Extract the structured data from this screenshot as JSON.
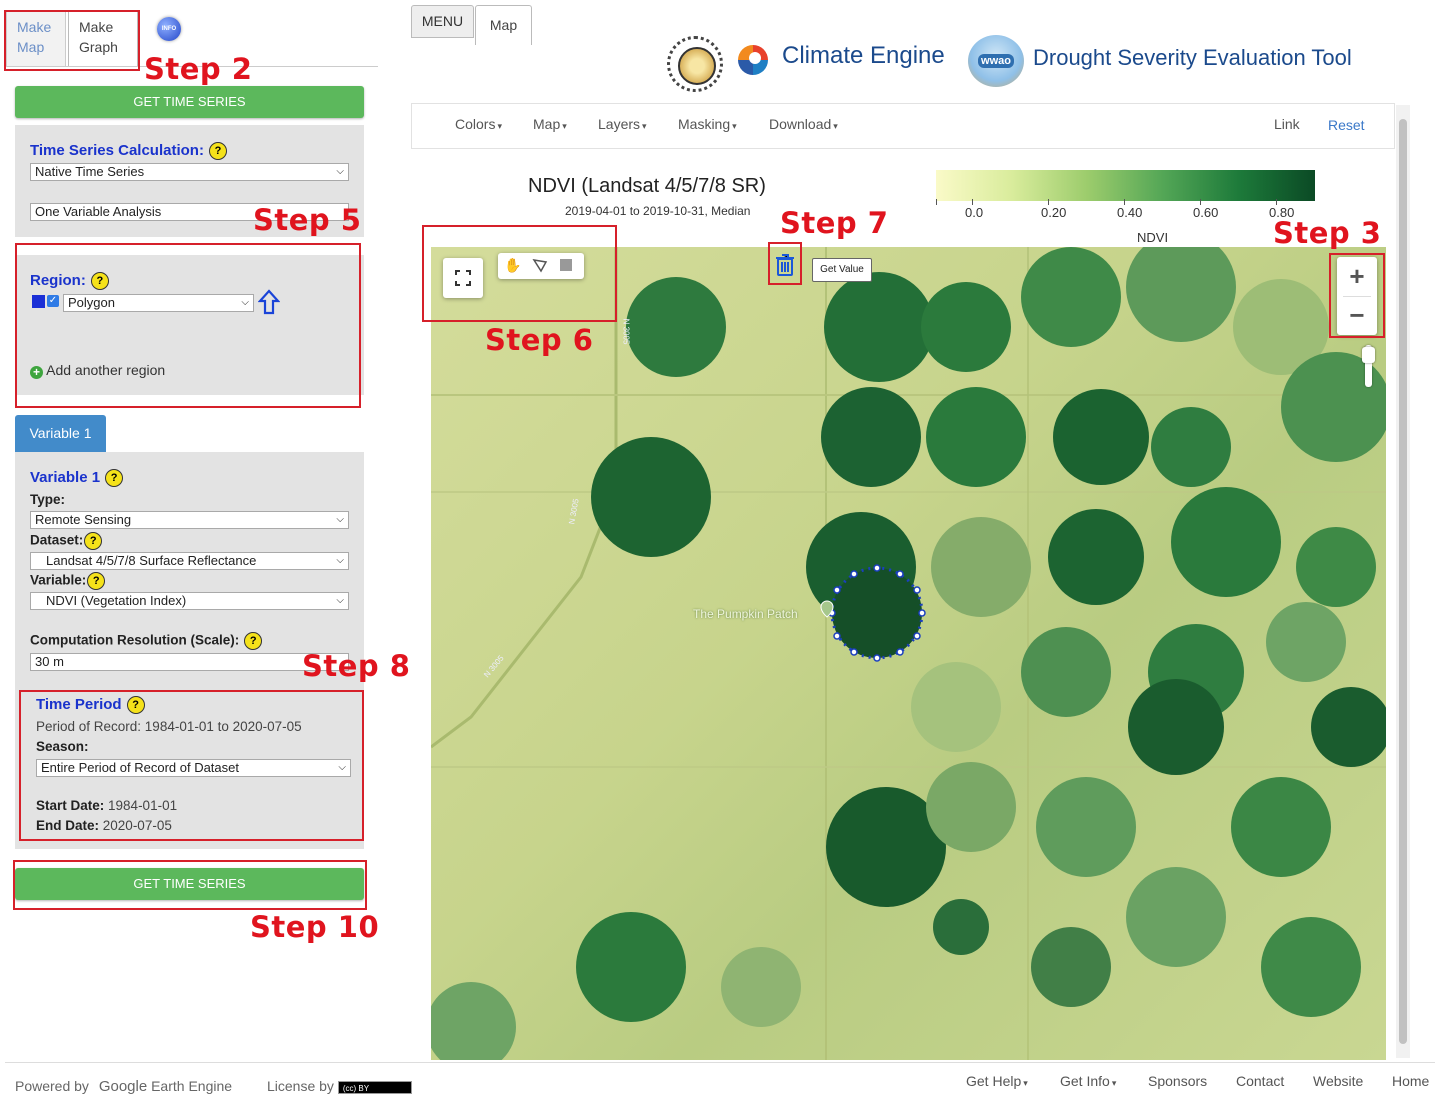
{
  "left_tabs": {
    "make_map": "Make Map",
    "make_graph": "Make Graph",
    "info_icon": "INFO"
  },
  "buttons": {
    "get_time_series_top": "GET TIME SERIES",
    "get_time_series_bottom": "GET TIME SERIES"
  },
  "time_series": {
    "title": "Time Series Calculation:",
    "calc_select": "Native Time Series",
    "analysis_select": "One Variable Analysis"
  },
  "region": {
    "title": "Region:",
    "shape_select": "Polygon",
    "add_region": "Add another region"
  },
  "variable_tab": "Variable 1",
  "variable": {
    "title": "Variable 1",
    "type_label": "Type:",
    "type_value": "Remote Sensing",
    "dataset_label": "Dataset:",
    "dataset_value": "Landsat 4/5/7/8 Surface Reflectance",
    "variable_label": "Variable:",
    "variable_value": "NDVI (Vegetation Index)",
    "resolution_label": "Computation Resolution (Scale):",
    "resolution_value": "30 m"
  },
  "time_period": {
    "title": "Time Period",
    "record": "Period of Record: 1984-01-01 to 2020-07-05",
    "season_label": "Season:",
    "season_value": "Entire Period of Record of Dataset",
    "start_label": "Start Date:",
    "start_value": "1984-01-01",
    "end_label": "End Date:",
    "end_value": "2020-07-05"
  },
  "steps": {
    "s2": "Step 2",
    "s3": "Step 3",
    "s5": "Step 5",
    "s6": "Step 6",
    "s7": "Step 7",
    "s8": "Step 8",
    "s10": "Step 10"
  },
  "top_tabs": {
    "menu": "MENU",
    "map": "Map"
  },
  "branding": {
    "climate_engine": "Climate Engine",
    "wwao": "wwao",
    "tool": "Drought Severity Evaluation Tool"
  },
  "toolbar": {
    "colors": "Colors",
    "map": "Map",
    "layers": "Layers",
    "masking": "Masking",
    "download": "Download",
    "link": "Link",
    "reset": "Reset"
  },
  "map_title": {
    "title": "NDVI (Landsat 4/5/7/8 SR)",
    "subtitle": "2019-04-01 to 2019-10-31, Median"
  },
  "legend": {
    "ticks": [
      "0.0",
      "0.20",
      "0.40",
      "0.60",
      "0.80"
    ],
    "label": "NDVI",
    "color_low": "#fafac8",
    "color_high": "#0b4a25"
  },
  "map": {
    "get_value": "Get Value",
    "place_label": "The Pumpkin Patch",
    "road_labels": [
      "N 3005",
      "N 3005",
      "N 3005"
    ],
    "zoom_in": "+",
    "zoom_out": "−"
  },
  "footer": {
    "powered_by": "Powered by",
    "google": "Google",
    "earth_engine": "Earth Engine",
    "license_by": "License by",
    "license_badge": "(cc) BY",
    "get_help": "Get Help",
    "get_info": "Get Info",
    "sponsors": "Sponsors",
    "contact": "Contact",
    "website": "Website",
    "home": "Home"
  },
  "colors": {
    "accent_green": "#5cb85c",
    "title_blue": "#1a33cc",
    "annotation_red": "#e0141e",
    "tab_blue": "#428bca"
  }
}
